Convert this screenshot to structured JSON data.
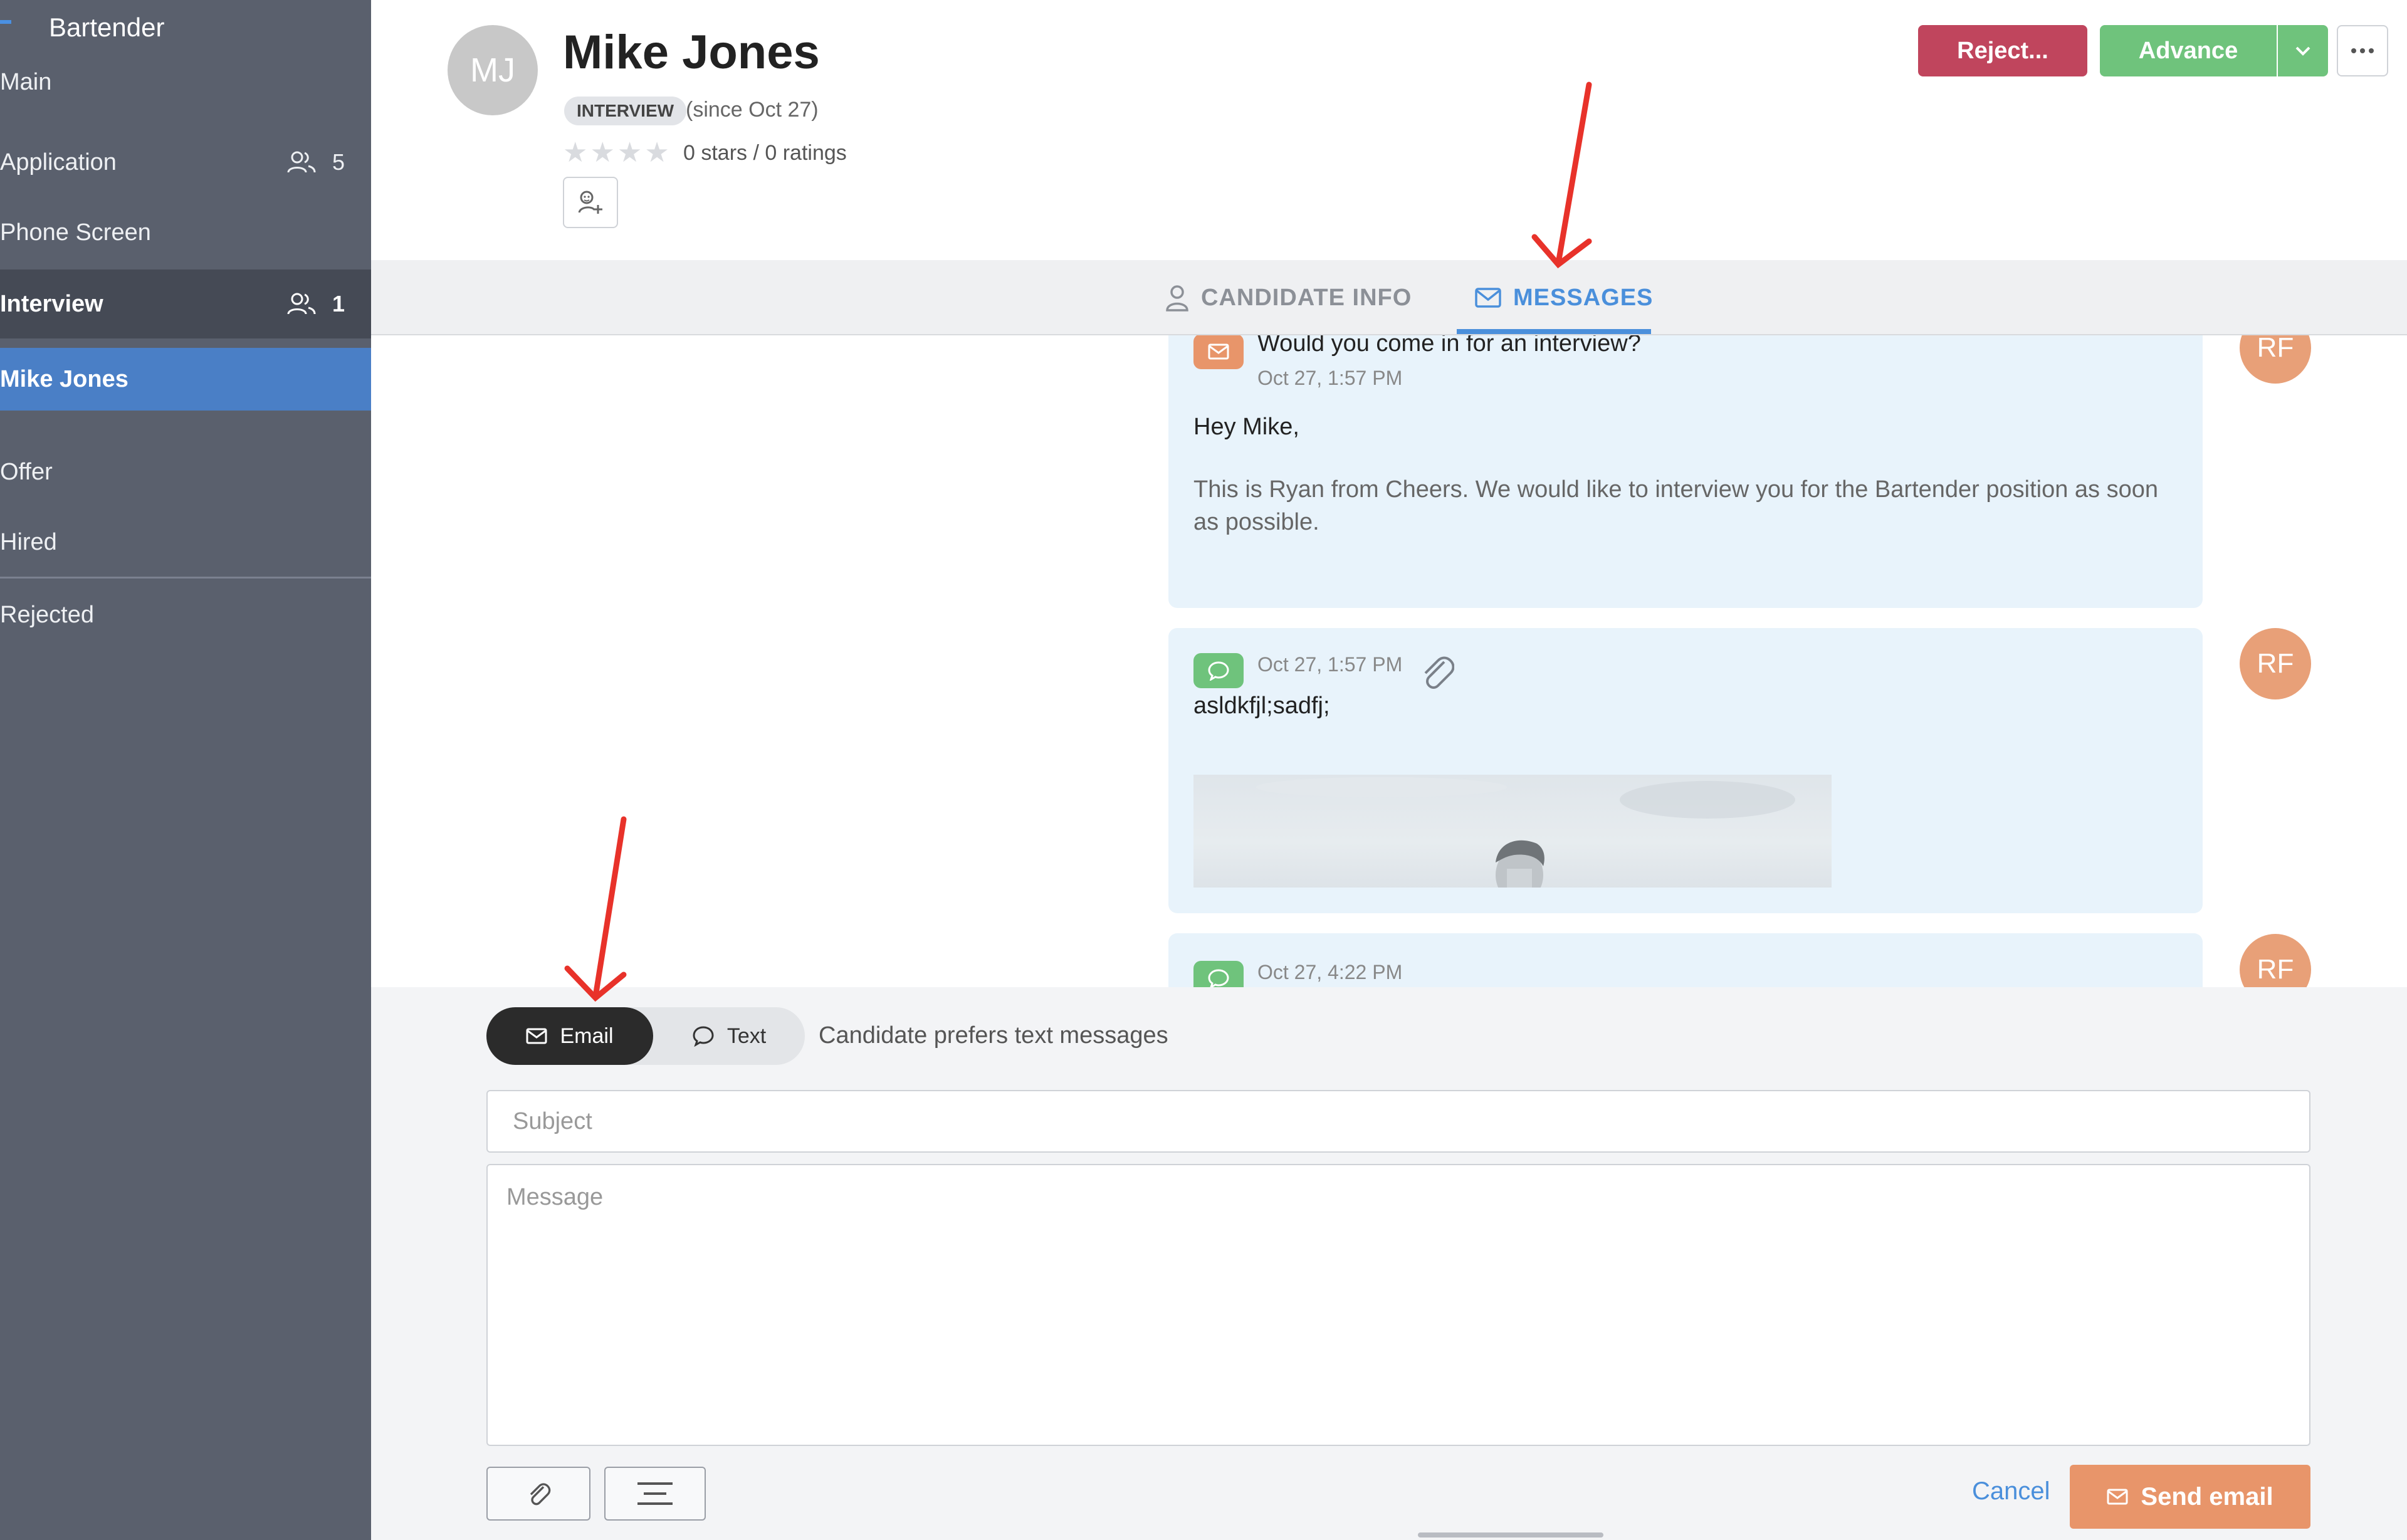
{
  "sidebar": {
    "title": "Bartender",
    "items": [
      {
        "label": "Main",
        "count": ""
      },
      {
        "label": "Application",
        "count": "5"
      },
      {
        "label": "Phone Screen",
        "count": ""
      },
      {
        "label": "Interview",
        "count": "1"
      },
      {
        "label": "Mike Jones",
        "count": ""
      },
      {
        "label": "Offer",
        "count": ""
      },
      {
        "label": "Hired",
        "count": ""
      },
      {
        "label": "Rejected",
        "count": ""
      }
    ]
  },
  "header": {
    "initials": "MJ",
    "name": "Mike Jones",
    "stage_badge": "INTERVIEW",
    "since": "(since Oct 27)",
    "ratings": "0 stars / 0 ratings",
    "reject_label": "Reject...",
    "advance_label": "Advance"
  },
  "tabs": {
    "candidate_info": "CANDIDATE INFO",
    "messages": "MESSAGES",
    "active": "messages"
  },
  "messages": [
    {
      "type": "email",
      "subject": "Would you come in for an interview?",
      "time": "Oct 27, 1:57 PM",
      "greeting": "Hey Mike,",
      "body": "This is Ryan from Cheers. We would like to interview you for the Bartender position as soon as possible.",
      "avatar": "RF"
    },
    {
      "type": "text",
      "time": "Oct 27, 1:57 PM",
      "body": "asldkfjl;sadfj;",
      "avatar": "RF",
      "has_attachment": true
    },
    {
      "type": "text",
      "time": "Oct 27, 4:22 PM",
      "avatar": "RF"
    }
  ],
  "composer": {
    "mode_email": "Email",
    "mode_text": "Text",
    "active_mode": "email",
    "preference_note": "Candidate prefers text messages",
    "subject_placeholder": "Subject",
    "message_placeholder": "Message",
    "cancel_label": "Cancel",
    "send_label": "Send email"
  },
  "colors": {
    "sidebar_bg": "#5a606d",
    "selected_item": "#4a7fc6",
    "reject": "#c0455d",
    "advance": "#6fc37c",
    "accent_blue": "#4a8fdb",
    "send": "#e8956a",
    "annotation_arrow": "#e8322a"
  }
}
